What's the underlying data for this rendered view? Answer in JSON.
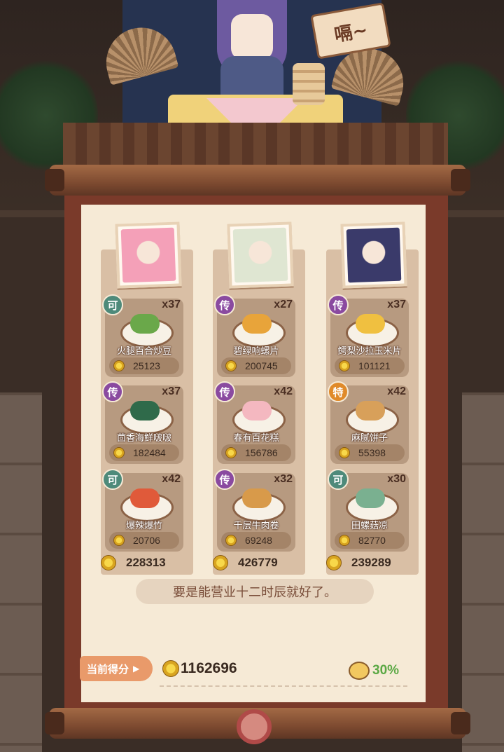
{
  "sign_text": "嗝~",
  "columns": [
    {
      "dishes": [
        {
          "badge": "可",
          "badge_color": "#4e8a7a",
          "qty": "x37",
          "name": "火腿百合炒豆",
          "price": "25123",
          "food_color": "#6aa84a"
        },
        {
          "badge": "传",
          "badge_color": "#8a4aa0",
          "qty": "x37",
          "name": "茴香海鲜啵啵",
          "price": "182484",
          "food_color": "#2f6a4a"
        },
        {
          "badge": "可",
          "badge_color": "#4e8a7a",
          "qty": "x42",
          "name": "爆辣爆竹",
          "price": "20706",
          "food_color": "#e05a3a"
        }
      ],
      "total": "228313",
      "portrait_color": "#f4a0b8"
    },
    {
      "dishes": [
        {
          "badge": "传",
          "badge_color": "#8a4aa0",
          "qty": "x27",
          "name": "碧绿响螺片",
          "price": "200745",
          "food_color": "#e8a43a"
        },
        {
          "badge": "传",
          "badge_color": "#8a4aa0",
          "qty": "x42",
          "name": "春有百花糕",
          "price": "156786",
          "food_color": "#f4b8c0"
        },
        {
          "badge": "传",
          "badge_color": "#8a4aa0",
          "qty": "x32",
          "name": "千层牛肉卷",
          "price": "69248",
          "food_color": "#d89a4a"
        }
      ],
      "total": "426779",
      "portrait_color": "#dfe6d2"
    },
    {
      "dishes": [
        {
          "badge": "传",
          "badge_color": "#8a4aa0",
          "qty": "x37",
          "name": "鳄梨沙拉玉米片",
          "price": "101121",
          "food_color": "#f0c040"
        },
        {
          "badge": "特",
          "badge_color": "#e08a2a",
          "qty": "x42",
          "name": "麻腻饼子",
          "price": "55398",
          "food_color": "#d8a05a"
        },
        {
          "badge": "可",
          "badge_color": "#4e8a7a",
          "qty": "x30",
          "name": "田螺菇凉",
          "price": "82770",
          "food_color": "#7ab090"
        }
      ],
      "total": "239289",
      "portrait_color": "#3a3a6a"
    }
  ],
  "quote": "要是能营业十二时辰就好了。",
  "score_label": "当前得分",
  "score_value": "1162696",
  "bonus_percent": "30%"
}
